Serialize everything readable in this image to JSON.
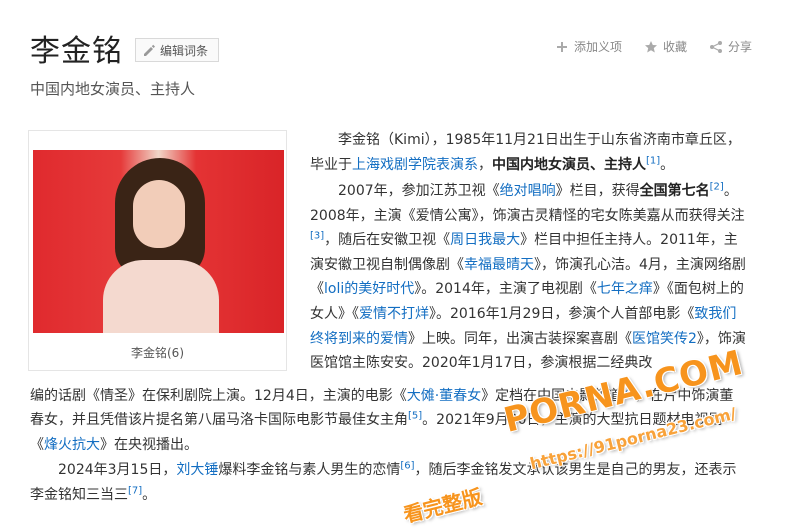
{
  "header": {
    "title": "李金铭",
    "edit_label": "编辑词条",
    "subtitle": "中国内地女演员、主持人",
    "actions": [
      {
        "label": "添加义项",
        "icon": "plus-icon"
      },
      {
        "label": "收藏",
        "icon": "star-icon"
      },
      {
        "label": "分享",
        "icon": "share-icon"
      }
    ]
  },
  "image": {
    "caption": "李金铭(6)"
  },
  "paragraph1": {
    "t1": "李金铭（Kimi），1985年11月21日出生于山东省济南市章丘区，毕业于",
    "link1": "上海戏剧学院表演系",
    "t2": "，",
    "bold1": "中国内地女演员、主持人",
    "ref1": "[1]",
    "t3": "。"
  },
  "paragraph2": {
    "t1": "2007年，参加江苏卫视《",
    "link1": "绝对唱响",
    "t2": "》栏目，获得",
    "bold1": "全国第七名",
    "ref2": "[2]",
    "t3": "。2008年，主演《爱情公寓》，饰演古灵精怪的宅女陈美嘉从而获得关注",
    "ref3": "[3]",
    "t4": "，随后在安徽卫视《",
    "link2": "周日我最大",
    "t5": "》栏目中担任主持人。2011年，主演安徽卫视自制偶像剧《",
    "link3": "幸福最晴天",
    "t6": "》，饰演孔心洁。4月，主演网络剧《",
    "link4": "loli的美好时代",
    "t7": "》。2014年，主演了电视剧《",
    "link5": "七年之痒",
    "t8": "》《面包树上的女人》《",
    "link6": "爱情不打烊",
    "t9": "》。2016年1月29日，参演个人首部电影《",
    "link7": "致我们终将到来的爱情",
    "t10": "》上映。同年，出演古装探案喜剧《",
    "link8": "医馆笑传2",
    "t11": "》，饰演医馆馆主陈安安。2020年1月17日，参演根据二",
    "t11b": "经典改"
  },
  "full_lines": {
    "l1_a": "编的话剧《情圣》在保利剧院上演。12月4日，主演的电影《",
    "l1_link": "大傩·董春女",
    "l1_b": "》定档在中国电影频道",
    "l1_ref": "[4]",
    "l1_c": "，在片中饰演董",
    "l2_a": "春女，并且凭借该片提名第八届马洛卡国际电影节最佳女主角",
    "l2_ref": "[5]",
    "l2_b": "。2021年9月20日，主演的大型抗日题材电视剧",
    "l3_a": "《",
    "l3_link": "烽火抗大",
    "l3_b": "》在央视播出。"
  },
  "paragraph3": {
    "t1": "2024年3月15日，",
    "link1": "刘大锤",
    "t2": "爆料李金铭与素人男生的恋情",
    "ref6": "[6]",
    "t3": "，随后李金铭发文承认该男生是自己的男友，还表示李金铭知三当三",
    "ref7": "[7]",
    "t4": "。"
  },
  "watermark": {
    "main": "PORNA.COM",
    "url": "https://91porna23.com/",
    "slogan": "看完整版"
  },
  "colors": {
    "link": "#136ec2",
    "watermark": "#f7941d",
    "photo_bg": "#e02a2e"
  }
}
